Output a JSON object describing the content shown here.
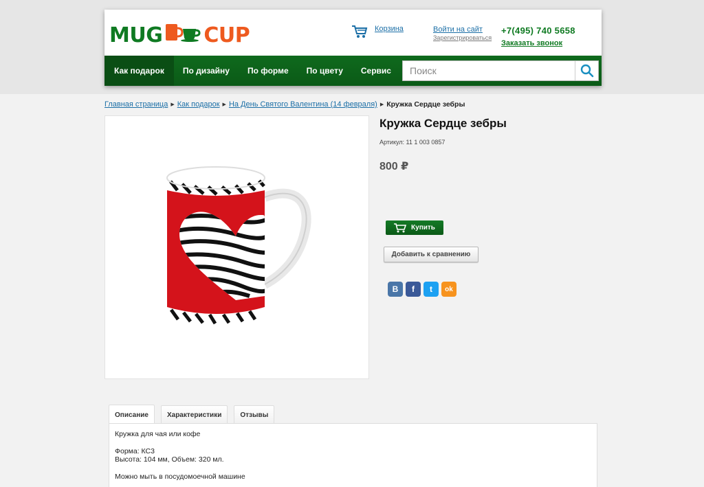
{
  "brand": {
    "logo_left": "MUG",
    "logo_right": "CUP",
    "primary_color": "#0f7a22",
    "accent_color": "#ee5a1f"
  },
  "header": {
    "cart_label": "Корзина",
    "login_label": "Войти на сайт",
    "register_label": "Зарегистрироваться",
    "phone": "+7(495) 740 5658",
    "callback_label": "Заказать звонок"
  },
  "nav": {
    "items": [
      {
        "label": "Как подарок",
        "active": true
      },
      {
        "label": "По дизайну"
      },
      {
        "label": "По форме"
      },
      {
        "label": "По цвету"
      },
      {
        "label": "Сервис"
      }
    ],
    "search_placeholder": "Поиск"
  },
  "breadcrumb": {
    "items": [
      "Главная страница",
      "Как подарок",
      "На День Святого Валентина (14 февраля)"
    ],
    "current": "Кружка Сердце зебры"
  },
  "product": {
    "title": "Кружка Сердце зебры",
    "sku": "Артикул: 11 1 003 0857",
    "price": "800 ₽",
    "image_alt": "Красная кружка с сердцем зебры",
    "buy_label": "Купить",
    "compare_label": "Добавить к сравнению"
  },
  "social": [
    {
      "name": "vk-icon",
      "glyph": "B",
      "color": "#4a76a8"
    },
    {
      "name": "facebook-icon",
      "glyph": "f",
      "color": "#3b5998"
    },
    {
      "name": "twitter-icon",
      "glyph": "t",
      "color": "#1da1f2"
    },
    {
      "name": "odnoklassniki-icon",
      "glyph": "ok",
      "color": "#f7931e"
    }
  ],
  "tabs": {
    "items": [
      {
        "label": "Описание",
        "active": true
      },
      {
        "label": "Характеристики"
      },
      {
        "label": "Отзывы"
      }
    ],
    "description": {
      "line1": "Кружка для чая или кофе",
      "line2": "Форма: КС3",
      "line3": "Высота: 104 мм, Объем: 320 мл.",
      "line4": "Можно мыть в посудомоечной машине"
    }
  }
}
